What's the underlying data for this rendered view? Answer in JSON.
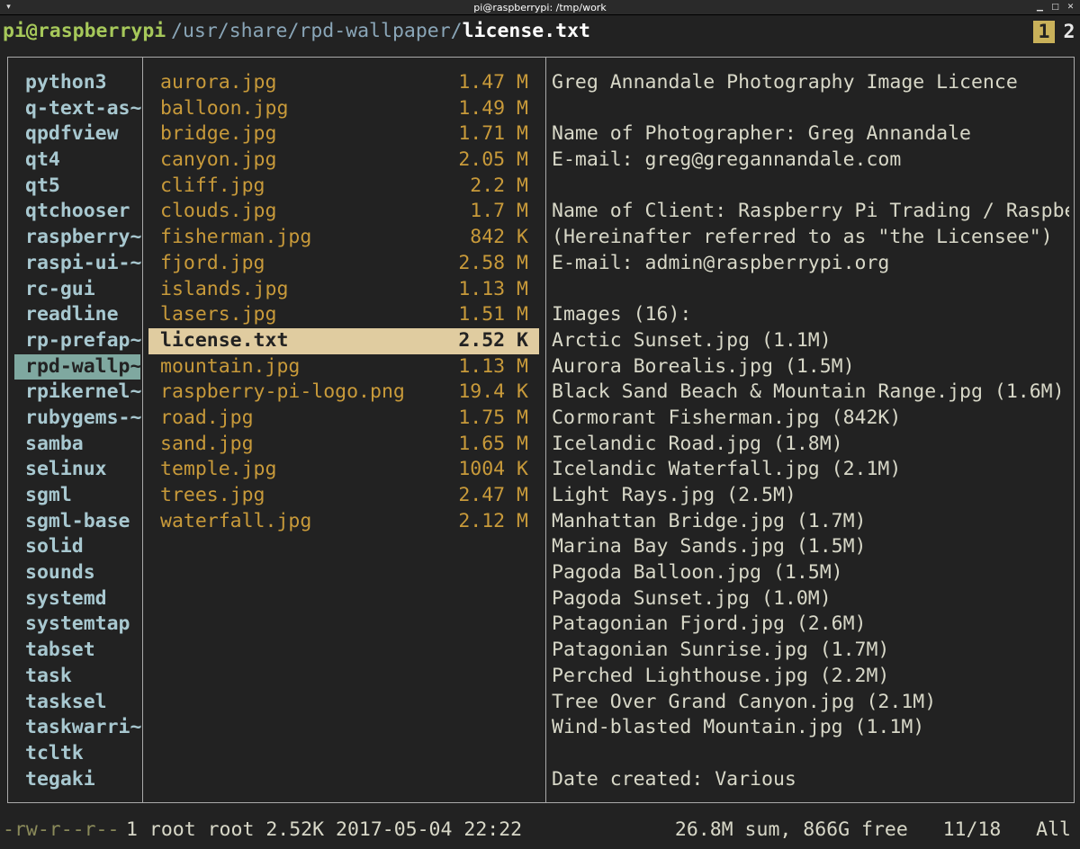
{
  "window": {
    "title": "pi@raspberrypi: /tmp/work"
  },
  "header": {
    "user_host": "pi@raspberrypi",
    "path": "/usr/share/rpd-wallpaper/",
    "file": "license.txt",
    "tabs": [
      "1",
      "2"
    ]
  },
  "parent_dirs": [
    "python3",
    "q-text-as~",
    "qpdfview",
    "qt4",
    "qt5",
    "qtchooser",
    "raspberry~",
    "raspi-ui-~",
    "rc-gui",
    "readline",
    "rp-prefap~",
    "rpd-wallp~",
    "rpikernel~",
    "rubygems-~",
    "samba",
    "selinux",
    "sgml",
    "sgml-base",
    "solid",
    "sounds",
    "systemd",
    "systemtap",
    "tabset",
    "task",
    "tasksel",
    "taskwarri~",
    "tcltk",
    "tegaki"
  ],
  "parent_selected_index": 11,
  "files": [
    {
      "name": "aurora.jpg",
      "size": "1.47 M"
    },
    {
      "name": "balloon.jpg",
      "size": "1.49 M"
    },
    {
      "name": "bridge.jpg",
      "size": "1.71 M"
    },
    {
      "name": "canyon.jpg",
      "size": "2.05 M"
    },
    {
      "name": "cliff.jpg",
      "size": "2.2 M"
    },
    {
      "name": "clouds.jpg",
      "size": "1.7 M"
    },
    {
      "name": "fisherman.jpg",
      "size": "842 K"
    },
    {
      "name": "fjord.jpg",
      "size": "2.58 M"
    },
    {
      "name": "islands.jpg",
      "size": "1.13 M"
    },
    {
      "name": "lasers.jpg",
      "size": "1.51 M"
    },
    {
      "name": "license.txt",
      "size": "2.52 K"
    },
    {
      "name": "mountain.jpg",
      "size": "1.13 M"
    },
    {
      "name": "raspberry-pi-logo.png",
      "size": "19.4 K"
    },
    {
      "name": "road.jpg",
      "size": "1.75 M"
    },
    {
      "name": "sand.jpg",
      "size": "1.65 M"
    },
    {
      "name": "temple.jpg",
      "size": "1004 K"
    },
    {
      "name": "trees.jpg",
      "size": "2.47 M"
    },
    {
      "name": "waterfall.jpg",
      "size": "2.12 M"
    }
  ],
  "files_selected_index": 10,
  "preview_lines": [
    "Greg Annandale Photography Image Licence",
    "",
    "Name of Photographer: Greg Annandale",
    "E-mail: greg@gregannandale.com",
    "",
    "Name of Client: Raspberry Pi Trading / Raspber",
    "(Hereinafter referred to as \"the Licensee\")",
    "E-mail: admin@raspberrypi.org",
    "",
    "Images (16):",
    "Arctic Sunset.jpg (1.1M)",
    "Aurora Borealis.jpg (1.5M)",
    "Black Sand Beach & Mountain Range.jpg (1.6M)",
    "Cormorant Fisherman.jpg (842K)",
    "Icelandic Road.jpg (1.8M)",
    "Icelandic Waterfall.jpg (2.1M)",
    "Light Rays.jpg (2.5M)",
    "Manhattan Bridge.jpg (1.7M)",
    "Marina Bay Sands.jpg (1.5M)",
    "Pagoda Balloon.jpg (1.5M)",
    "Pagoda Sunset.jpg (1.0M)",
    "Patagonian Fjord.jpg (2.6M)",
    "Patagonian Sunrise.jpg (1.7M)",
    "Perched Lighthouse.jpg (2.2M)",
    "Tree Over Grand Canyon.jpg (2.1M)",
    "Wind-blasted Mountain.jpg (1.1M)",
    "",
    "Date created: Various"
  ],
  "status": {
    "permissions": "-rw-r--r--",
    "info": "1 root root 2.52K 2017-05-04 22:22",
    "summary": "26.8M sum, 866G free   11/18   All"
  }
}
